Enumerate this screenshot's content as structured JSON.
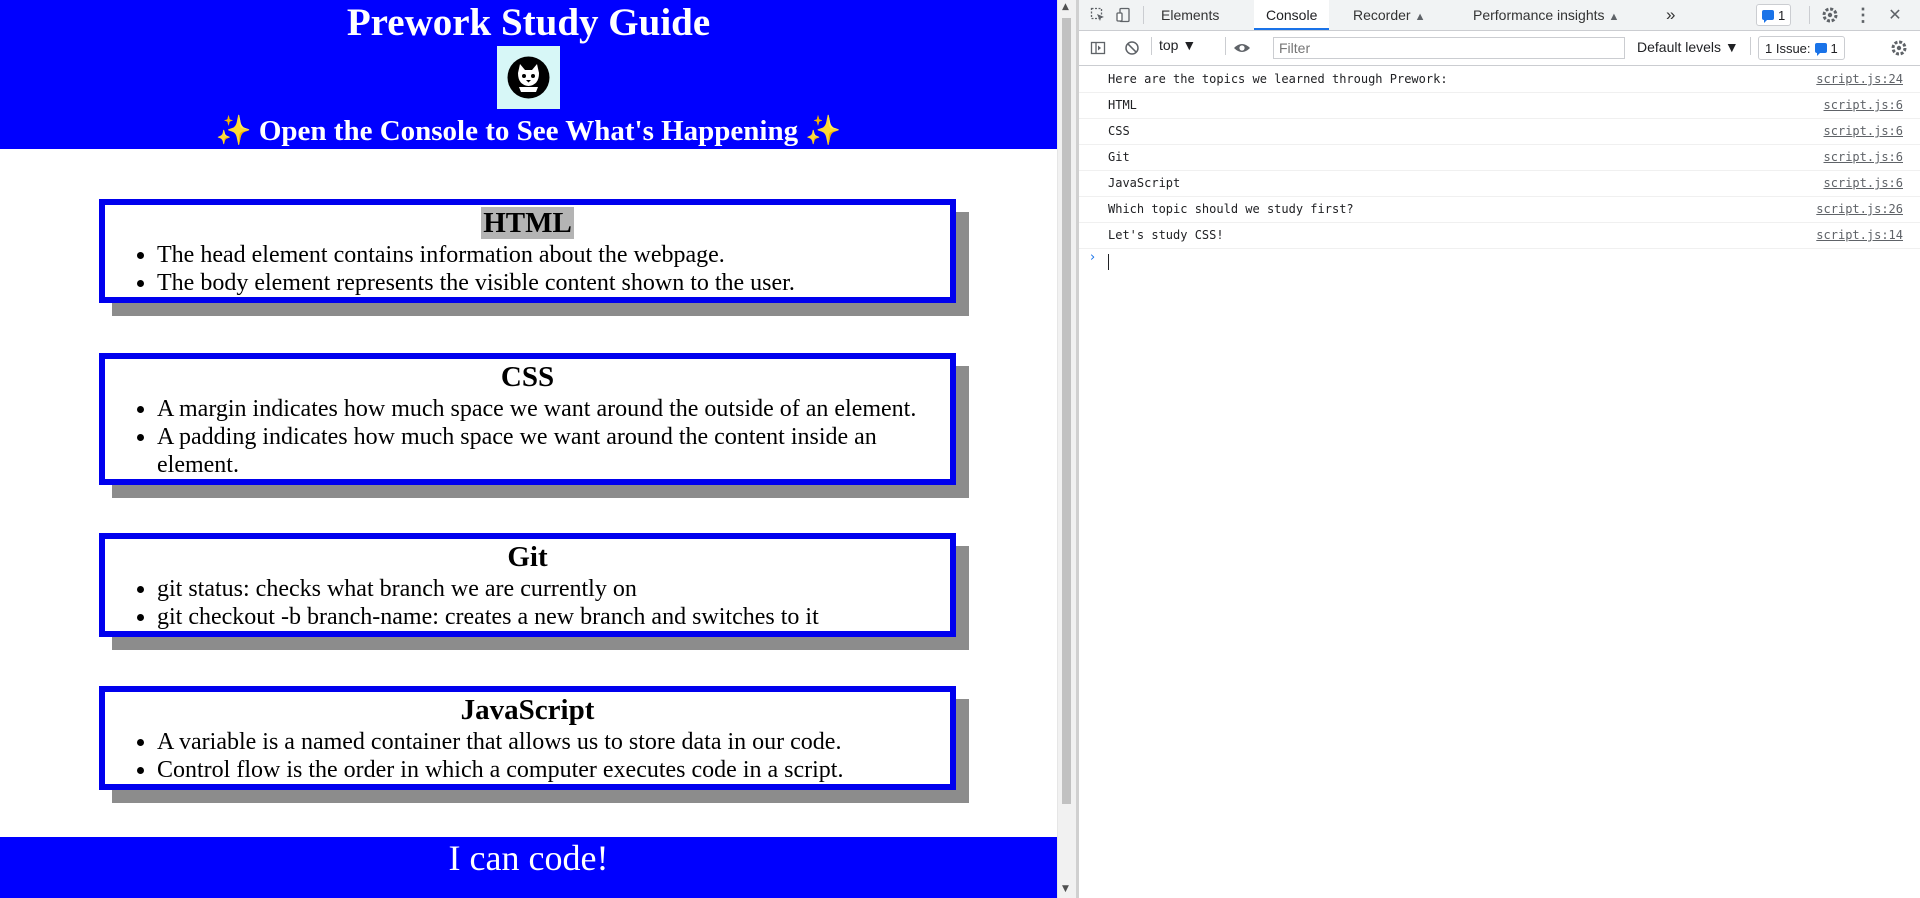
{
  "page": {
    "title": "Prework Study Guide",
    "subtitle": "Open the Console to See What's Happening",
    "sparkle": "✨",
    "footer": "I can code!",
    "topics": [
      {
        "heading": "HTML",
        "items": [
          "The head element contains information about the webpage.",
          "The body element represents the visible content shown to the user."
        ]
      },
      {
        "heading": "CSS",
        "items": [
          "A margin indicates how much space we want around the outside of an element.",
          "A padding indicates how much space we want around the content inside an element."
        ]
      },
      {
        "heading": "Git",
        "items": [
          "git status: checks what branch we are currently on",
          "git checkout -b branch-name: creates a new branch and switches to it"
        ]
      },
      {
        "heading": "JavaScript",
        "items": [
          "A variable is a named container that allows us to store data in our code.",
          "Control flow is the order in which a computer executes code in a script."
        ]
      }
    ],
    "colors": {
      "header_bg": "#0000ff",
      "card_border": "#0000ee",
      "card_shadow": "#8c8c8c"
    }
  },
  "devtools": {
    "tabs": [
      "Elements",
      "Console",
      "Recorder",
      "Performance insights"
    ],
    "active_tab": "Console",
    "more_tabs": "»",
    "message_count": "1",
    "context": "top ▼",
    "filter_placeholder": "Filter",
    "levels": "Default levels ▼",
    "issues_label": "1 Issue:",
    "issues_count": "1",
    "console_rows": [
      {
        "text": "Here are the topics we learned through Prework:",
        "source": "script.js:24"
      },
      {
        "text": "HTML",
        "source": "script.js:6"
      },
      {
        "text": "CSS",
        "source": "script.js:6"
      },
      {
        "text": "Git",
        "source": "script.js:6"
      },
      {
        "text": "JavaScript",
        "source": "script.js:6"
      },
      {
        "text": "Which topic should we study first?",
        "source": "script.js:26"
      },
      {
        "text": "Let's study CSS!",
        "source": "script.js:14"
      }
    ],
    "prompt": "›"
  }
}
